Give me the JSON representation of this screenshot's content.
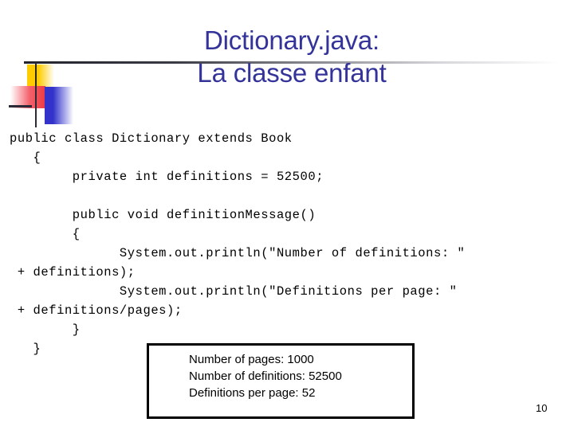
{
  "slide": {
    "title_lines": [
      "Dictionary.java:",
      "La classe enfant"
    ],
    "title_color": "#333399",
    "background_color": "#FFFFFF",
    "page_number": "10"
  },
  "decoration": {
    "yellow_color": "#FFCC00",
    "red_color": "#ED3B43",
    "blue_color": "#3333CC",
    "line_color": "#2B2B38"
  },
  "code": {
    "language": "java",
    "lines": [
      "public class Dictionary extends Book",
      "   {",
      "        private int definitions = 52500;",
      "",
      "        public void definitionMessage()",
      "        {",
      "              System.out.println(\"Number of definitions: \"",
      " + definitions);",
      "              System.out.println(\"Definitions per page: \"",
      " + definitions/pages);",
      "        }",
      "   }"
    ]
  },
  "output_box": {
    "lines": [
      "Number of pages: 1000",
      "Number of definitions: 52500",
      "Definitions per page: 52"
    ],
    "border_color": "#000000"
  }
}
